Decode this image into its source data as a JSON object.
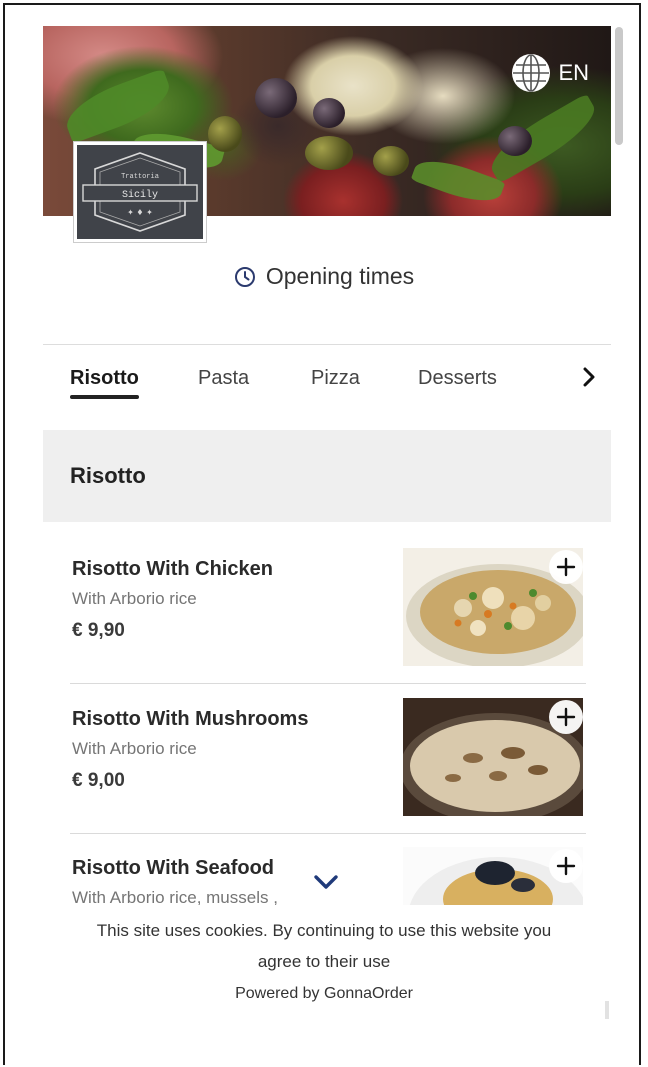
{
  "header": {
    "language": "EN",
    "logo_top_text": "Trattoria",
    "logo_name": "Sicily"
  },
  "info": {
    "opening_times": "Opening times"
  },
  "tabs": [
    {
      "label": "Risotto",
      "active": true
    },
    {
      "label": "Pasta",
      "active": false
    },
    {
      "label": "Pizza",
      "active": false
    },
    {
      "label": "Desserts",
      "active": false
    }
  ],
  "section": {
    "title": "Risotto"
  },
  "items": [
    {
      "name": "Risotto With Chicken",
      "description": "With Arborio rice",
      "price": "€ 9,90"
    },
    {
      "name": "Risotto With Mushrooms",
      "description": "With Arborio rice",
      "price": "€ 9,00"
    },
    {
      "name": "Risotto With Seafood",
      "description": "With Arborio rice, mussels ,",
      "price": ""
    }
  ],
  "footer": {
    "cookie_line1": "This site uses cookies. By continuing to use this website you",
    "cookie_line2": "agree to their use",
    "powered_by": "Powered by GonnaOrder"
  },
  "icons": {
    "language": "globe-icon",
    "opening": "clock-icon",
    "tabs_next": "chevron-right-icon",
    "add": "plus-icon",
    "expand": "chevron-down-icon"
  },
  "colors": {
    "accent_dark": "#222222",
    "section_bg": "#efefef",
    "expand_chevron": "#1f3a7a"
  }
}
